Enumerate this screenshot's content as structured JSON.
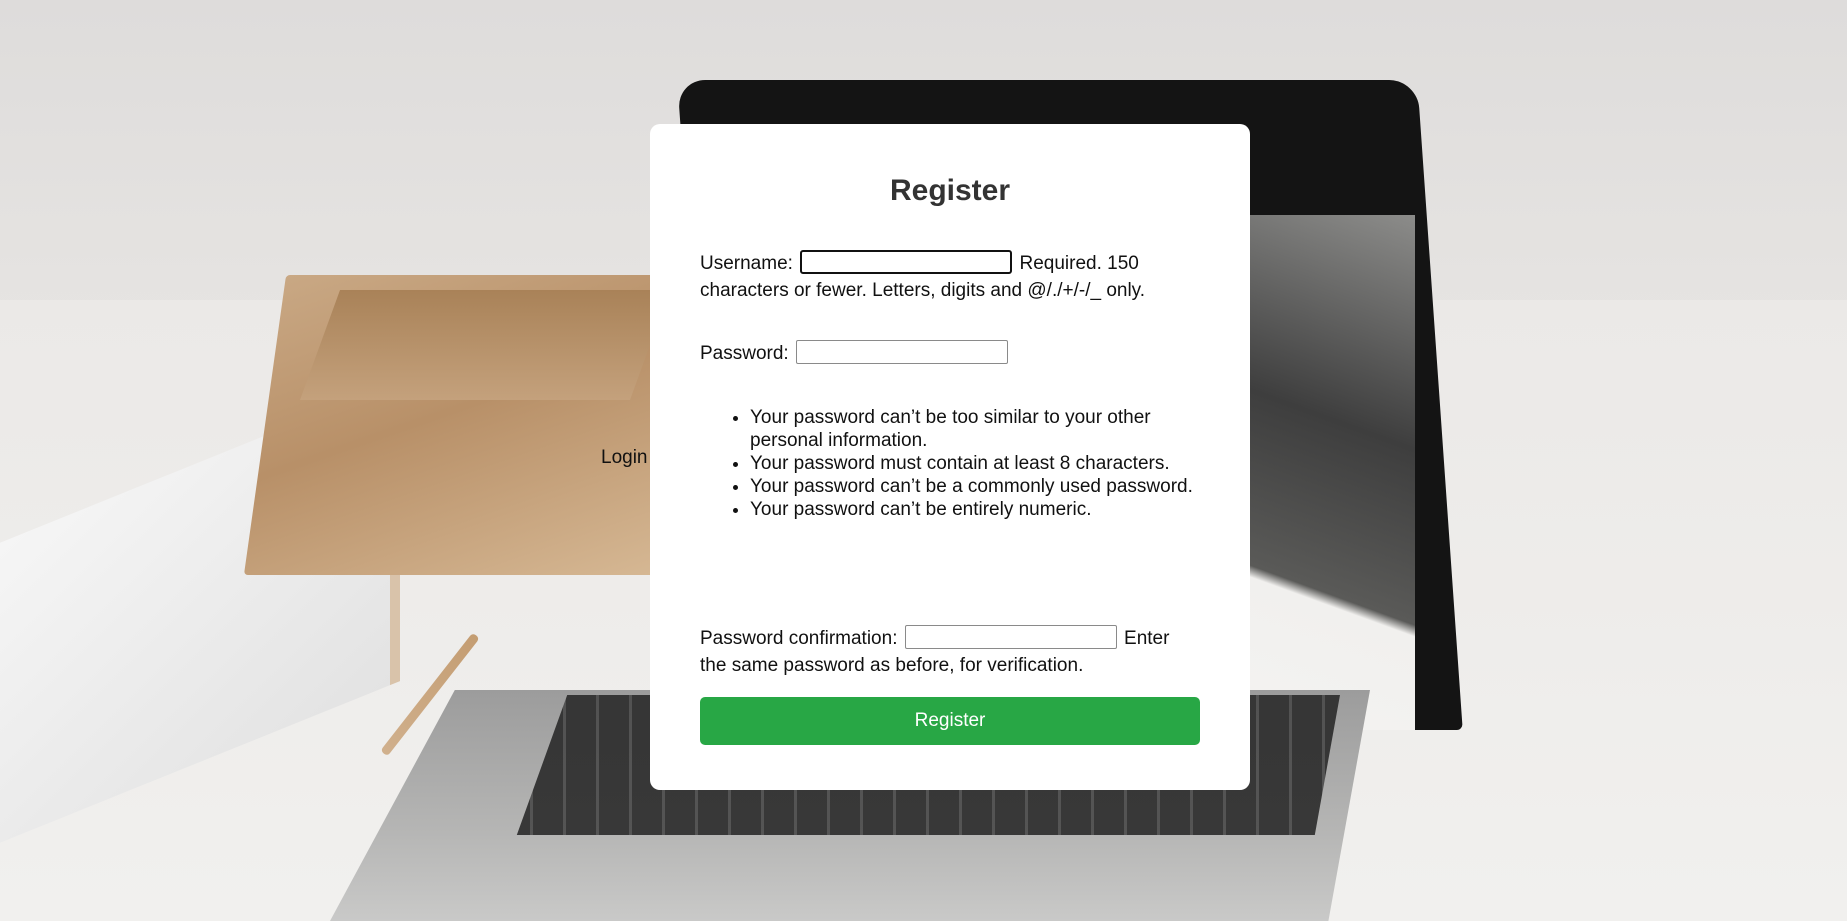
{
  "background": {
    "behind_link_text": "Login"
  },
  "form": {
    "title": "Register",
    "username": {
      "label": "Username:",
      "value": "",
      "help": "Required. 150 characters or fewer. Letters, digits and @/./+/-/_ only."
    },
    "password": {
      "label": "Password:",
      "value": "",
      "rules": [
        "Your password can’t be too similar to your other personal information.",
        "Your password must contain at least 8 characters.",
        "Your password can’t be a commonly used password.",
        "Your password can’t be entirely numeric."
      ]
    },
    "password_confirmation": {
      "label": "Password confirmation:",
      "value": "",
      "help": "Enter the same password as before, for verification."
    },
    "submit_label": "Register"
  },
  "colors": {
    "submit_bg": "#28a745",
    "card_bg": "#ffffff",
    "title_text": "#333333"
  }
}
